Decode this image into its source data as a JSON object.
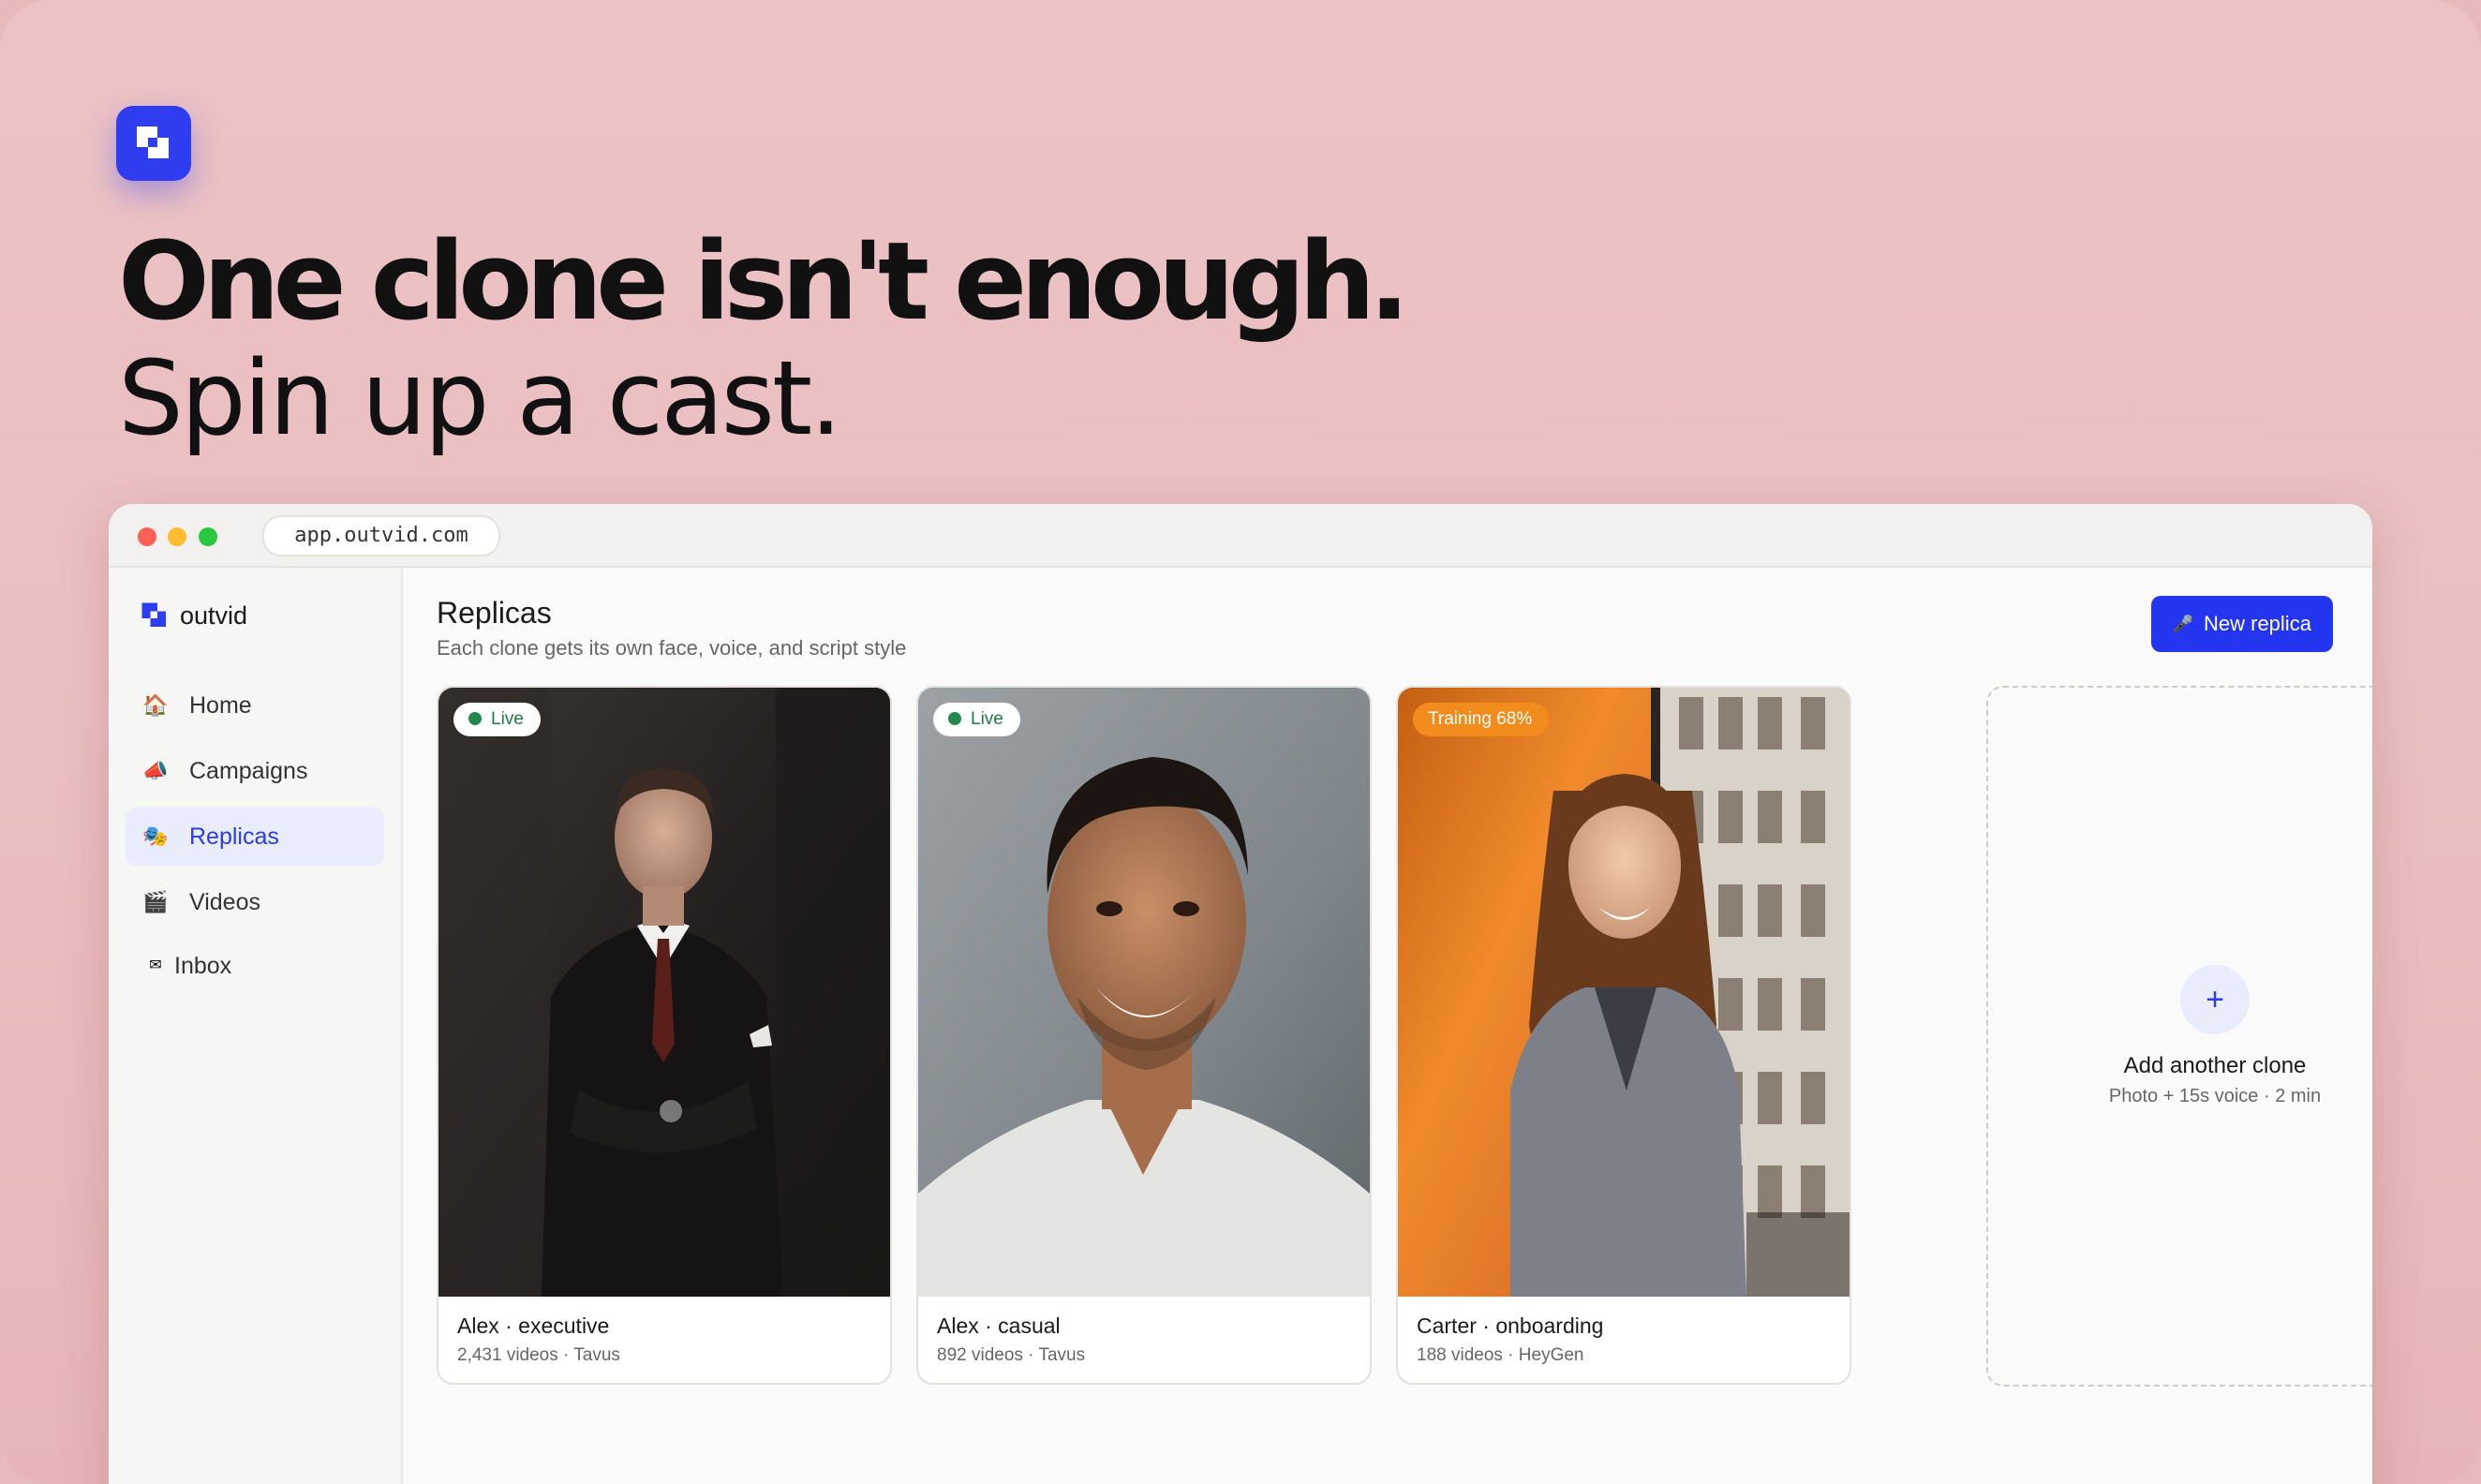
{
  "hero": {
    "headline": "One clone isn't enough.",
    "subheadline": "Spin up a cast.",
    "logo_icon": "outvid-logo-icon"
  },
  "browser": {
    "url": "app.outvid.com"
  },
  "sidebar": {
    "brand": "outvid",
    "items": [
      {
        "label": "Home",
        "icon": "house-icon",
        "glyph": "🏠",
        "active": false
      },
      {
        "label": "Campaigns",
        "icon": "megaphone-icon",
        "glyph": "📣",
        "active": false
      },
      {
        "label": "Replicas",
        "icon": "masks-icon",
        "glyph": "🎭",
        "active": true
      },
      {
        "label": "Videos",
        "icon": "clapperboard-icon",
        "glyph": "🎬",
        "active": false
      },
      {
        "label": "Inbox",
        "icon": "envelope-icon",
        "glyph": "✉",
        "active": false
      }
    ]
  },
  "main": {
    "title": "Replicas",
    "subtitle": "Each clone gets its own face, voice, and script style",
    "new_button": {
      "label": "New replica",
      "icon": "microphone-icon",
      "glyph": "🎤"
    },
    "cards": [
      {
        "badge": "Live",
        "status": "live",
        "name": "Alex · executive",
        "meta": "2,431 videos · Tavus",
        "photo": "man-in-suit-photo"
      },
      {
        "badge": "Live",
        "status": "live",
        "name": "Alex · casual",
        "meta": "892 videos · Tavus",
        "photo": "smiling-man-photo"
      },
      {
        "badge": "Training 68%",
        "status": "training",
        "training_progress": 0.68,
        "name": "Carter · onboarding",
        "meta": "188 videos · HeyGen",
        "photo": "woman-by-window-photo"
      }
    ],
    "add_card": {
      "plus": "+",
      "title": "Add another clone",
      "subtitle": "Photo + 15s voice · 2 min"
    }
  },
  "colors": {
    "background": "#ebbfc1",
    "accent": "#2435ef",
    "live_green": "#1f8a4c",
    "training_orange": "#f28c1c"
  }
}
